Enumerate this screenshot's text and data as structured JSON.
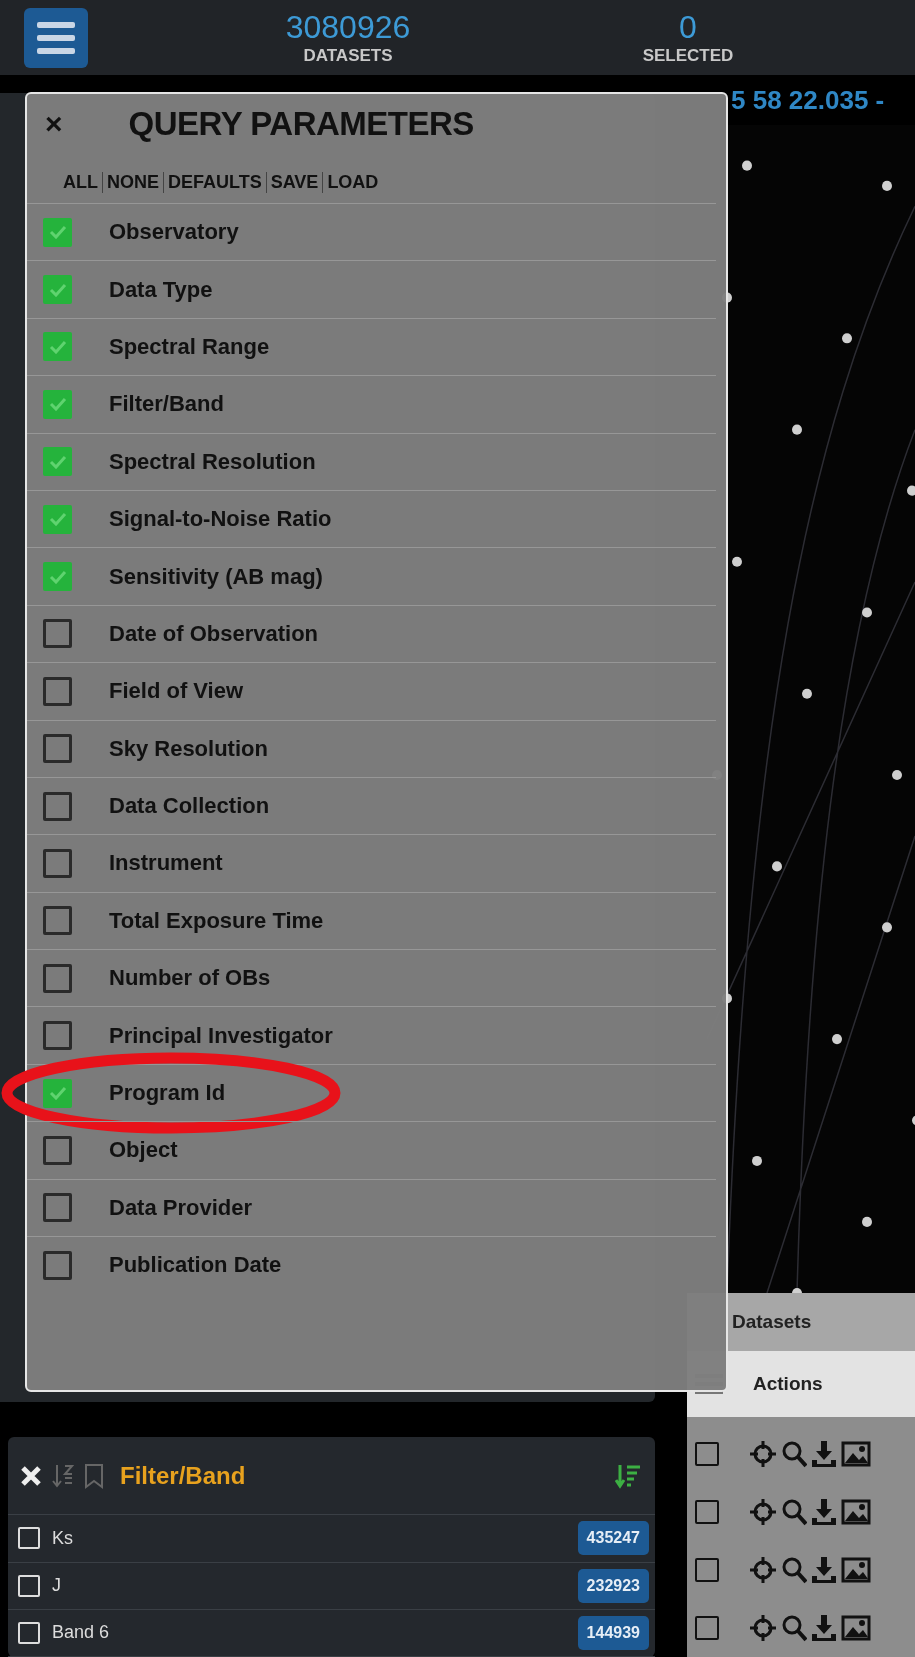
{
  "top_bar": {
    "datasets_count": "3080926",
    "datasets_label": "DATASETS",
    "selected_count": "0",
    "selected_label": "SELECTED"
  },
  "sky_view": {
    "coordinates": "5 58 22.035 -"
  },
  "query_parameters": {
    "title": "QUERY PARAMETERS",
    "close": "×",
    "actions": [
      "ALL",
      "NONE",
      "DEFAULTS",
      "SAVE",
      "LOAD"
    ],
    "parameters": [
      {
        "label": "Observatory",
        "checked": true,
        "circled": false
      },
      {
        "label": "Data Type",
        "checked": true,
        "circled": false
      },
      {
        "label": "Spectral Range",
        "checked": true,
        "circled": false
      },
      {
        "label": "Filter/Band",
        "checked": true,
        "circled": false
      },
      {
        "label": "Spectral Resolution",
        "checked": true,
        "circled": false
      },
      {
        "label": "Signal-to-Noise Ratio",
        "checked": true,
        "circled": false
      },
      {
        "label": "Sensitivity (AB mag)",
        "checked": true,
        "circled": false
      },
      {
        "label": "Date of Observation",
        "checked": false,
        "circled": false
      },
      {
        "label": "Field of View",
        "checked": false,
        "circled": false
      },
      {
        "label": "Sky Resolution",
        "checked": false,
        "circled": false
      },
      {
        "label": "Data Collection",
        "checked": false,
        "circled": false
      },
      {
        "label": "Instrument",
        "checked": false,
        "circled": false
      },
      {
        "label": "Total Exposure Time",
        "checked": false,
        "circled": false
      },
      {
        "label": "Number of OBs",
        "checked": false,
        "circled": false
      },
      {
        "label": "Principal Investigator",
        "checked": false,
        "circled": false
      },
      {
        "label": "Program Id",
        "checked": true,
        "circled": true
      },
      {
        "label": "Object",
        "checked": false,
        "circled": false
      },
      {
        "label": "Data Provider",
        "checked": false,
        "circled": false
      },
      {
        "label": "Publication Date",
        "checked": false,
        "circled": false
      }
    ]
  },
  "filter_panel": {
    "title": "Filter/Band",
    "items": [
      {
        "label": "Ks",
        "count": "435247",
        "checked": false
      },
      {
        "label": "J",
        "count": "232923",
        "checked": false
      },
      {
        "label": "Band 6",
        "count": "144939",
        "checked": false
      }
    ]
  },
  "datasets_table": {
    "title": "Datasets",
    "column": "Actions",
    "rows": [
      {
        "checked": false
      },
      {
        "checked": false
      },
      {
        "checked": false
      },
      {
        "checked": false
      }
    ]
  }
}
